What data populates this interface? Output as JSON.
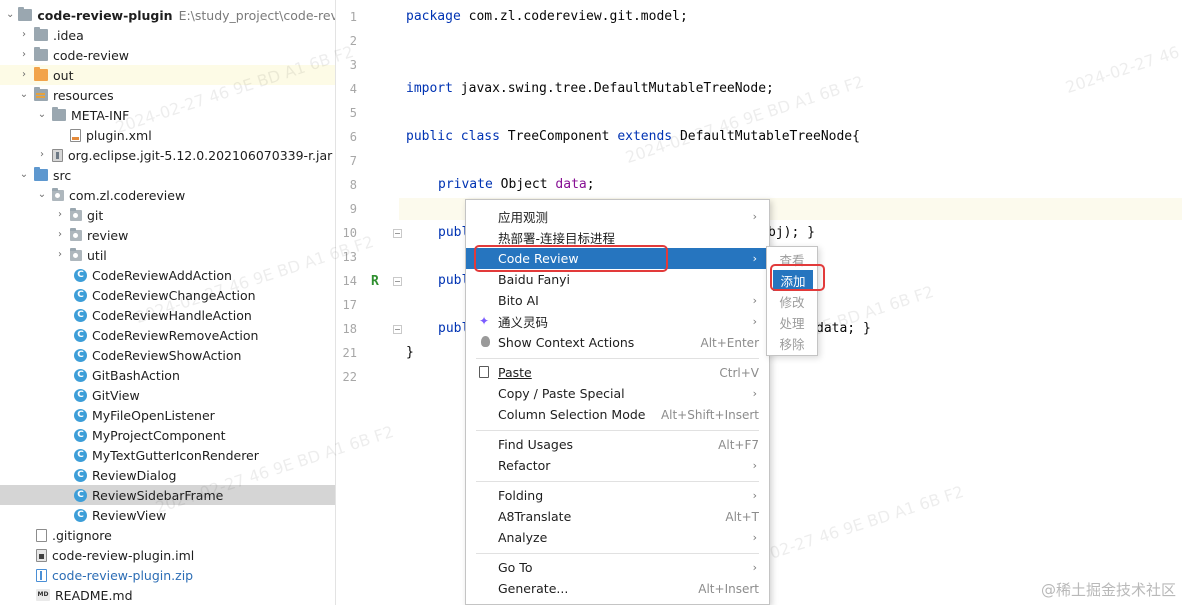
{
  "project_tree": {
    "root_name": "code-review-plugin",
    "root_path": "E:\\study_project\\code-review-",
    "items": [
      {
        "label": ".idea"
      },
      {
        "label": "code-review"
      },
      {
        "label": "out"
      },
      {
        "label": "resources"
      },
      {
        "label": "META-INF"
      },
      {
        "label": "plugin.xml"
      },
      {
        "label": "org.eclipse.jgit-5.12.0.202106070339-r.jar"
      },
      {
        "label": "src"
      },
      {
        "label": "com.zl.codereview"
      },
      {
        "label": "git"
      },
      {
        "label": "review"
      },
      {
        "label": "util"
      },
      {
        "label": "CodeReviewAddAction"
      },
      {
        "label": "CodeReviewChangeAction"
      },
      {
        "label": "CodeReviewHandleAction"
      },
      {
        "label": "CodeReviewRemoveAction"
      },
      {
        "label": "CodeReviewShowAction"
      },
      {
        "label": "GitBashAction"
      },
      {
        "label": "GitView"
      },
      {
        "label": "MyFileOpenListener"
      },
      {
        "label": "MyProjectComponent"
      },
      {
        "label": "MyTextGutterIconRenderer"
      },
      {
        "label": "ReviewDialog"
      },
      {
        "label": "ReviewSidebarFrame"
      },
      {
        "label": "ReviewView"
      },
      {
        "label": ".gitignore"
      },
      {
        "label": "code-review-plugin.iml"
      },
      {
        "label": "code-review-plugin.zip"
      },
      {
        "label": "README.md"
      }
    ],
    "selected_item": "ReviewSidebarFrame"
  },
  "editor": {
    "line_numbers": [
      "1",
      "2",
      "3",
      "4",
      "5",
      "6",
      "7",
      "8",
      "9",
      "10",
      "13",
      "14",
      "17",
      "18",
      "21",
      "22"
    ],
    "gutter_marker": "R",
    "code": {
      "l1_kw": "package",
      "l1_rest": " com.zl.codereview.git.model;",
      "l4_kw": "import",
      "l4_rest": " javax.swing.tree.DefaultMutableTreeNode;",
      "l6_kw1": "public class",
      "l6_mid": " TreeComponent ",
      "l6_kw2": "extends",
      "l6_rest": " DefaultMutableTreeNode{",
      "l8_kw": "private",
      "l8_mid": " Object ",
      "l8_field": "data",
      "l8_rest": ";",
      "l10_kw": "publ",
      "l10_tail": "bj); }",
      "l14_kw": "publ",
      "l18_kw": "publ",
      "l18_tail": "data; }",
      "l21": "}"
    }
  },
  "context_menu": {
    "items": [
      {
        "label": "应用观测",
        "has_submenu": true
      },
      {
        "label": "热部署-连接目标进程"
      },
      {
        "label": "Code Review",
        "has_submenu": true,
        "highlighted": true
      },
      {
        "label": "Baidu Fanyi"
      },
      {
        "label": "Bito AI",
        "has_submenu": true
      },
      {
        "label": "通义灵码",
        "has_submenu": true,
        "icon": "tongyi-icon"
      },
      {
        "label": "Show Context Actions",
        "shortcut": "Alt+Enter",
        "icon": "lightbulb-icon"
      },
      {
        "label": "Paste",
        "shortcut": "Ctrl+V",
        "icon": "clipboard-icon"
      },
      {
        "label": "Copy / Paste Special",
        "has_submenu": true
      },
      {
        "label": "Column Selection Mode",
        "shortcut": "Alt+Shift+Insert"
      },
      {
        "label": "Find Usages",
        "shortcut": "Alt+F7"
      },
      {
        "label": "Refactor",
        "has_submenu": true
      },
      {
        "label": "Folding",
        "has_submenu": true
      },
      {
        "label": "A8Translate",
        "shortcut": "Alt+T"
      },
      {
        "label": "Analyze",
        "has_submenu": true
      },
      {
        "label": "Go To",
        "has_submenu": true
      },
      {
        "label": "Generate...",
        "shortcut": "Alt+Insert"
      }
    ]
  },
  "code_review_submenu": {
    "items": [
      {
        "label": "查看",
        "enabled": false
      },
      {
        "label": "添加",
        "enabled": true,
        "highlighted": true
      },
      {
        "label": "修改",
        "enabled": false
      },
      {
        "label": "处理",
        "enabled": false
      },
      {
        "label": "移除",
        "enabled": false
      }
    ]
  },
  "watermark_text": "2024-02-27 46 9E BD A1 6B F2",
  "credit": "@稀土掘金技术社区",
  "colors": {
    "highlight": "#2675bf",
    "annotation_red": "#e23a3a",
    "keyword": "#0033b3",
    "field": "#871094"
  }
}
